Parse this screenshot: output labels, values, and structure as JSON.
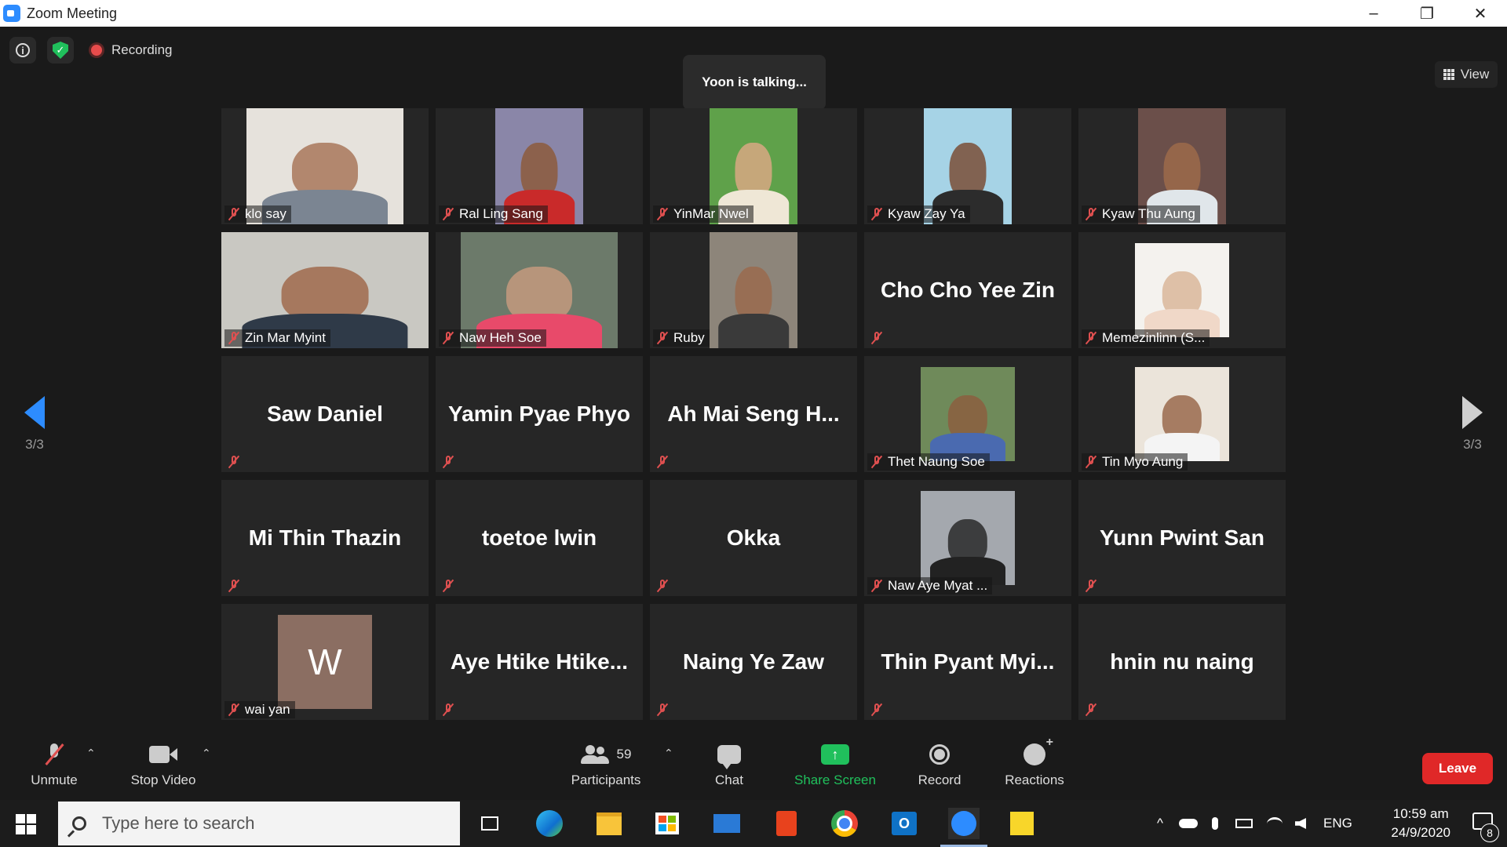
{
  "window": {
    "title": "Zoom Meeting",
    "controls": [
      "–",
      "❐",
      "✕"
    ]
  },
  "topbar": {
    "recording_label": "Recording",
    "talking_indicator": "Yoon is talking...",
    "view_label": "View"
  },
  "pagination": {
    "left_label": "3/3",
    "right_label": "3/3"
  },
  "participants": [
    {
      "name": "klo say",
      "video": true,
      "muted": true,
      "bg": "#e6e2dc",
      "skin": "#a8775a",
      "shirt": "#7b8592",
      "vclass": "w200"
    },
    {
      "name": "Ral Ling Sang",
      "video": true,
      "muted": true,
      "bg": "#8a86a8",
      "skin": "#8c5a3c",
      "shirt": "#c92a2a",
      "vclass": "w112"
    },
    {
      "name": "YinMar Nwel",
      "video": true,
      "muted": true,
      "bg": "#5fa14a",
      "skin": "#d8a882",
      "shirt": "#efe7d6",
      "vclass": "w112"
    },
    {
      "name": "Kyaw Zay Ya",
      "video": true,
      "muted": true,
      "bg": "#a6d3e6",
      "skin": "#7a4e36",
      "shirt": "#2c2c2c",
      "vclass": "w112"
    },
    {
      "name": "Kyaw Thu Aung",
      "video": true,
      "muted": true,
      "bg": "#6b4f4a",
      "skin": "#9c6a4a",
      "shirt": "#e0e6ea",
      "vclass": "w112"
    },
    {
      "name": "Zin Mar Myint",
      "video": true,
      "muted": true,
      "bg": "#c9c8c2",
      "skin": "#a06a4c",
      "shirt": "#2f3a48",
      "vclass": "wide"
    },
    {
      "name": "Naw Heh Soe",
      "video": true,
      "muted": true,
      "bg": "#6c7a6a",
      "skin": "#c49a7e",
      "shirt": "#e84a6a",
      "vclass": "w200"
    },
    {
      "name": "Ruby",
      "video": true,
      "muted": true,
      "bg": "#8d857a",
      "skin": "#9a6a4e",
      "shirt": "#3a3a3a",
      "vclass": "w112"
    },
    {
      "name": "Cho Cho Yee Zin",
      "video": false,
      "muted": true
    },
    {
      "name": "Memezinlinn (S...",
      "video": true,
      "muted": true,
      "bg": "#f4f2ee",
      "skin": "#d9b79a",
      "shirt": "#f0d8c8",
      "vclass": "w120"
    },
    {
      "name": "Saw Daniel",
      "video": false,
      "muted": true
    },
    {
      "name": "Yamin Pyae Phyo",
      "video": false,
      "muted": true
    },
    {
      "name": "Ah Mai Seng H...",
      "video": false,
      "muted": true
    },
    {
      "name": "Thet Naung Soe",
      "video": true,
      "muted": true,
      "bg": "#6f8a5a",
      "skin": "#8c5e40",
      "shirt": "#4a6ab0",
      "vclass": "w120"
    },
    {
      "name": "Tin Myo Aung",
      "video": true,
      "muted": true,
      "bg": "#ebe4da",
      "skin": "#9a6a4c",
      "shirt": "#f4f4f4",
      "vclass": "w120"
    },
    {
      "name": "Mi Thin Thazin",
      "video": false,
      "muted": true
    },
    {
      "name": "toetoe lwin",
      "video": false,
      "muted": true
    },
    {
      "name": "Okka",
      "video": false,
      "muted": true
    },
    {
      "name": "Naw Aye Myat ...",
      "video": true,
      "muted": true,
      "bg": "#a4a8ae",
      "skin": "#2a2a2a",
      "shirt": "#222222",
      "vclass": "w120"
    },
    {
      "name": "Yunn Pwint San",
      "video": false,
      "muted": true
    },
    {
      "name": "wai yan",
      "video": false,
      "avatar": "W",
      "muted": true
    },
    {
      "name": "Aye Htike Htike...",
      "video": false,
      "muted": true
    },
    {
      "name": "Naing Ye Zaw",
      "video": false,
      "muted": true
    },
    {
      "name": "Thin Pyant Myi...",
      "video": false,
      "muted": true
    },
    {
      "name": "hnin nu naing",
      "video": false,
      "muted": true
    }
  ],
  "toolbar": {
    "unmute_label": "Unmute",
    "stop_video_label": "Stop Video",
    "participants_label": "Participants",
    "participants_count": "59",
    "chat_label": "Chat",
    "share_screen_label": "Share Screen",
    "record_label": "Record",
    "reactions_label": "Reactions",
    "leave_label": "Leave",
    "caret": "⌃",
    "share_arrow": "↑"
  },
  "taskbar": {
    "search_placeholder": "Type here to search",
    "language": "ENG",
    "time": "10:59 am",
    "date": "24/9/2020",
    "notification_count": "8",
    "apps": [
      "task-view-icon",
      "edge-icon",
      "file-explorer-icon",
      "store-icon",
      "mail-icon",
      "office-icon",
      "chrome-icon",
      "outlook-icon",
      "zoom-icon",
      "sticky-notes-icon"
    ]
  },
  "colors": {
    "accent_blue": "#2d8cff",
    "share_green": "#20c05c",
    "leave_red": "#e02828",
    "mute_red": "#e05050"
  }
}
